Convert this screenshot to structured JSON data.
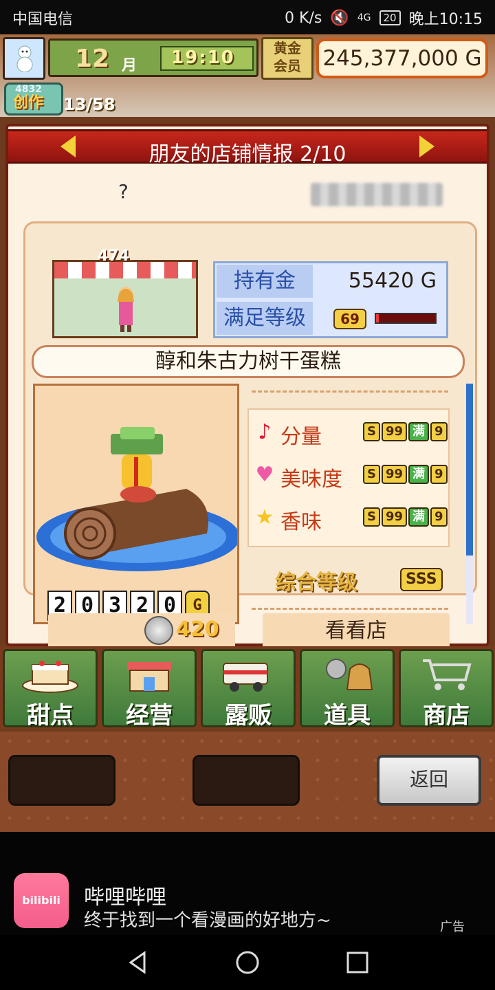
{
  "status_bar": {
    "carrier": "中国电信",
    "net_speed": "0 K/s",
    "signal": "4G",
    "battery": "20",
    "time": "晚上10:15"
  },
  "hud": {
    "month_num": "12",
    "month_unit": "月",
    "time": "19:10",
    "gold_member": [
      "黄金",
      "会员"
    ],
    "money": "245,377,000 G",
    "create_label": "创作",
    "create_count": "13/58",
    "create_small": "4832"
  },
  "dialog": {
    "title": "朋友的店铺情报 2/10",
    "unknown_mark": "?",
    "shop_rank": "474",
    "stats": {
      "money_label": "持有金",
      "money_value": "55420 G",
      "satisfaction_label": "满足等级",
      "satisfaction_level": "69",
      "satisfaction_fill": 0.05
    },
    "recipe_name": "醇和朱古力树干蛋糕",
    "price_digits": [
      "2",
      "0",
      "3",
      "2",
      "0",
      "G"
    ],
    "attributes": [
      {
        "icon": "♪",
        "icon_color": "#e2182f",
        "label": "分量",
        "grade_prefix": "S",
        "grade_mid": "99",
        "grade_tag": "满",
        "grade_end": "9"
      },
      {
        "icon": "♥",
        "icon_color": "#ee5aa6",
        "label": "美味度",
        "grade_prefix": "S",
        "grade_mid": "99",
        "grade_tag": "满",
        "grade_end": "9"
      },
      {
        "icon": "★",
        "icon_color": "#f5c41f",
        "label": "香味",
        "grade_prefix": "S",
        "grade_mid": "99",
        "grade_tag": "满",
        "grade_end": "9"
      }
    ],
    "overall_label": "综合等级",
    "overall_grade": "SSS",
    "coin_value": "420",
    "visit_label": "看看店"
  },
  "menu": [
    {
      "label": "甜点"
    },
    {
      "label": "经营"
    },
    {
      "label": "露贩"
    },
    {
      "label": "道具"
    },
    {
      "label": "商店"
    }
  ],
  "back_label": "返回",
  "ad": {
    "logo_text": "bilibili",
    "title": "哔哩哔哩",
    "subtitle": "终于找到一个看漫画的好地方~",
    "tag": "广告"
  },
  "colors": {
    "header_red": "#c7271b",
    "panel_cream": "#fdf2e2",
    "menu_green": "#3f7a3b"
  }
}
